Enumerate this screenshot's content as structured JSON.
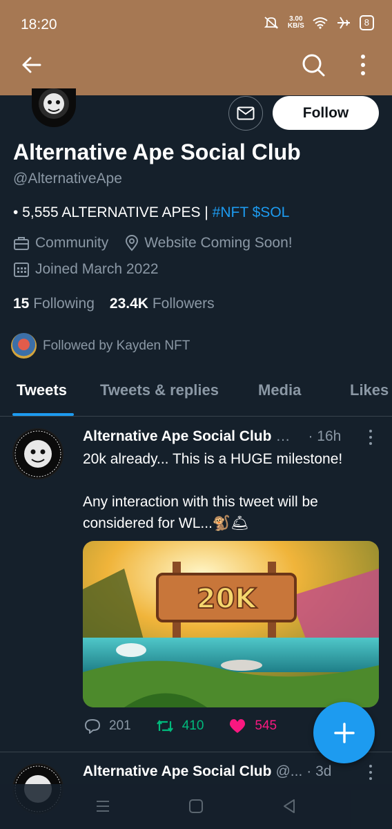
{
  "status_bar": {
    "time": "18:20",
    "net_speed_value": "3.00",
    "net_speed_unit": "KB/S",
    "battery": "8"
  },
  "profile": {
    "name": "Alternative Ape Social Club",
    "handle": "@AlternativeApe",
    "bio_prefix": "• 5,555 ALTERNATIVE APES | ",
    "bio_links": "#NFT $SOL",
    "category": "Community",
    "location": "Website Coming Soon!",
    "joined": "Joined March 2022",
    "following_count": "15",
    "following_label": "Following",
    "followers_count": "23.4K",
    "followers_label": "Followers",
    "followed_by": "Followed by Kayden NFT",
    "follow_label": "Follow"
  },
  "tabs": [
    {
      "label": "Tweets",
      "active": true
    },
    {
      "label": "Tweets & replies",
      "active": false
    },
    {
      "label": "Media",
      "active": false
    },
    {
      "label": "Likes",
      "active": false
    }
  ],
  "tweets": [
    {
      "name": "Alternative Ape Social Club",
      "handle": "…",
      "time": "· 16h",
      "text_line1": "20k already... This is a HUGE milestone!",
      "text_line2": "",
      "text_line3": "Any interaction with this tweet will be",
      "text_line4": "considered for WL...🐒🛎",
      "media_caption": "20K",
      "replies": "201",
      "retweets": "410",
      "likes": "545"
    },
    {
      "name": "Alternative Ape Social Club",
      "handle": "@...",
      "time": "· 3d"
    }
  ],
  "colors": {
    "app_bar": "#a67853",
    "background": "#15202b",
    "accent": "#1d9bf0",
    "retweet": "#00ba7c",
    "like": "#f91880",
    "muted": "#8b98a5"
  },
  "icons": [
    "back-arrow-icon",
    "search-icon",
    "more-vertical-icon",
    "mail-icon",
    "briefcase-icon",
    "location-icon",
    "calendar-icon",
    "reply-icon",
    "retweet-icon",
    "heart-icon",
    "plus-icon",
    "menu-icon",
    "home-square-icon",
    "back-triangle-icon"
  ]
}
